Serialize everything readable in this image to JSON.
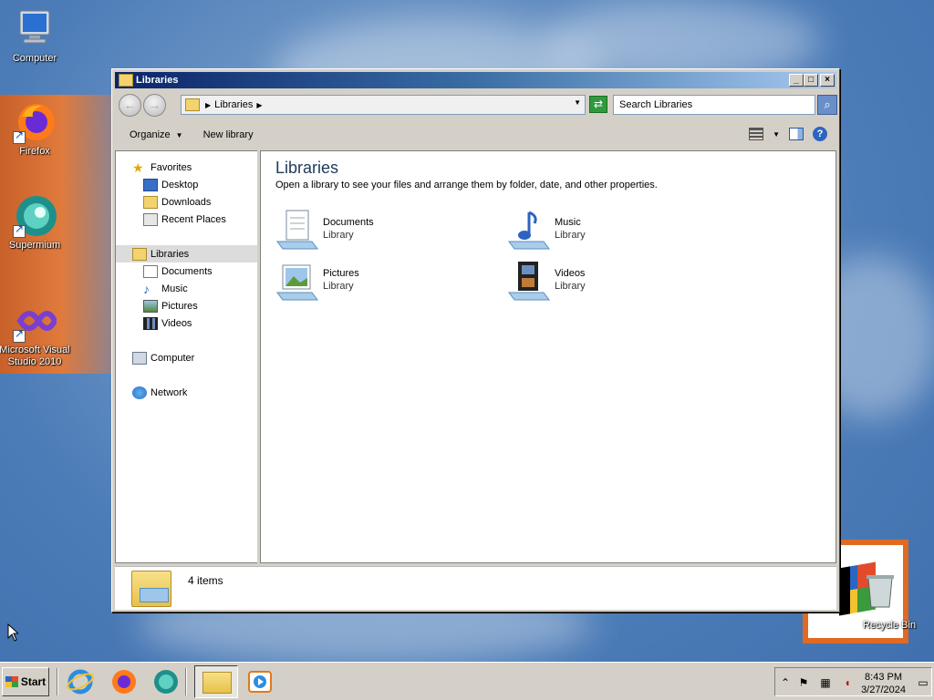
{
  "desktop": {
    "icons": [
      {
        "label": "Computer"
      },
      {
        "label": "Firefox"
      },
      {
        "label": "Supermium"
      },
      {
        "label": "Microsoft Visual Studio 2010"
      },
      {
        "label": "Recycle Bin"
      }
    ]
  },
  "window": {
    "title": "Libraries",
    "address": {
      "crumb": "Libraries"
    },
    "search": {
      "placeholder": "Search Libraries"
    },
    "toolbar": {
      "organize": "Organize",
      "new_library": "New library"
    },
    "nav": {
      "favorites": "Favorites",
      "desktop": "Desktop",
      "downloads": "Downloads",
      "recent_places": "Recent Places",
      "libraries": "Libraries",
      "documents": "Documents",
      "music": "Music",
      "pictures": "Pictures",
      "videos": "Videos",
      "computer": "Computer",
      "network": "Network"
    },
    "content": {
      "heading": "Libraries",
      "description": "Open a library to see your files and arrange them by folder, date, and other properties.",
      "items": [
        {
          "name": "Documents",
          "type": "Library"
        },
        {
          "name": "Music",
          "type": "Library"
        },
        {
          "name": "Pictures",
          "type": "Library"
        },
        {
          "name": "Videos",
          "type": "Library"
        }
      ]
    },
    "status": {
      "count": "4 items"
    }
  },
  "taskbar": {
    "start": "Start",
    "clock": {
      "time": "8:43 PM",
      "date": "3/27/2024"
    }
  },
  "colors": {
    "desktop_blue": "#4d7db8",
    "title_bar": "#0a246a",
    "heading_text": "#1e395b",
    "selected_nav": "#dcdcdc"
  }
}
